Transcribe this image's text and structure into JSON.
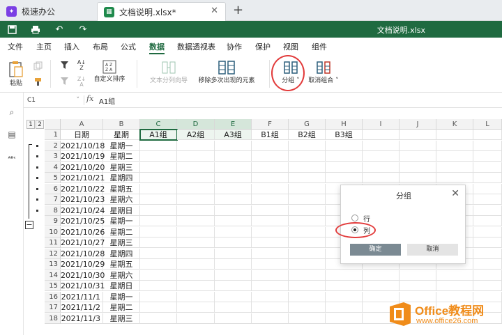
{
  "tabs": [
    {
      "label": "极速办公",
      "icon": "app-logo-icon",
      "color": "#7b3fe4"
    },
    {
      "label": "文档说明.xlsx*",
      "icon": "spreadsheet-icon",
      "color": "#1f8a4c"
    }
  ],
  "title_bar": {
    "doc_title": "文档说明.xlsx",
    "color": "#1f6a40"
  },
  "menu": {
    "items": [
      "文件",
      "主页",
      "插入",
      "布局",
      "公式",
      "数据",
      "数据透视表",
      "协作",
      "保护",
      "视图",
      "组件"
    ],
    "active": "数据"
  },
  "ribbon": {
    "paste": "粘贴",
    "custom_sort": "自定义排序",
    "text_to_columns": "文本分列向导",
    "remove_duplicates": "移除多次出现的元素",
    "group": "分组",
    "ungroup": "取消组合"
  },
  "formula": {
    "cell_ref": "C1",
    "fx": "fx",
    "value": "A1组"
  },
  "outline_levels": [
    "1",
    "2"
  ],
  "columns": [
    "A",
    "B",
    "C",
    "D",
    "E",
    "F",
    "G",
    "H",
    "I",
    "J",
    "K",
    "L"
  ],
  "header_row": [
    "日期",
    "星期",
    "A1组",
    "A2组",
    "A3组",
    "B1组",
    "B2组",
    "B3组"
  ],
  "rows": [
    {
      "n": "2",
      "date": "2021/10/18",
      "day": "星期一"
    },
    {
      "n": "3",
      "date": "2021/10/19",
      "day": "星期二"
    },
    {
      "n": "4",
      "date": "2021/10/20",
      "day": "星期三"
    },
    {
      "n": "5",
      "date": "2021/10/21",
      "day": "星期四"
    },
    {
      "n": "6",
      "date": "2021/10/22",
      "day": "星期五"
    },
    {
      "n": "7",
      "date": "2021/10/23",
      "day": "星期六"
    },
    {
      "n": "8",
      "date": "2021/10/24",
      "day": "星期日"
    },
    {
      "n": "9",
      "date": "2021/10/25",
      "day": "星期一"
    },
    {
      "n": "10",
      "date": "2021/10/26",
      "day": "星期二"
    },
    {
      "n": "11",
      "date": "2021/10/27",
      "day": "星期三"
    },
    {
      "n": "12",
      "date": "2021/10/28",
      "day": "星期四"
    },
    {
      "n": "13",
      "date": "2021/10/29",
      "day": "星期五"
    },
    {
      "n": "14",
      "date": "2021/10/30",
      "day": "星期六"
    },
    {
      "n": "15",
      "date": "2021/10/31",
      "day": "星期日"
    },
    {
      "n": "16",
      "date": "2021/11/1",
      "day": "星期一"
    },
    {
      "n": "17",
      "date": "2021/11/2",
      "day": "星期二"
    },
    {
      "n": "18",
      "date": "2021/11/3",
      "day": "星期三"
    }
  ],
  "dialog": {
    "title": "分组",
    "option_row": "行",
    "option_col": "列",
    "selected": "列",
    "ok": "确定",
    "cancel": "取消"
  },
  "watermark": {
    "line1": "Office教程网",
    "line2": "www.office26.com"
  }
}
